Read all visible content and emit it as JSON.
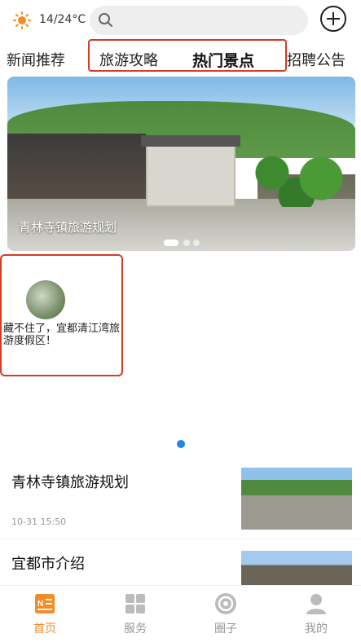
{
  "header": {
    "weather_icon": "sun-icon",
    "temperature": "14/24°C",
    "search_placeholder": "",
    "add_icon": "plus-circle-icon"
  },
  "tabs": [
    {
      "label": "新闻推荐",
      "active": false
    },
    {
      "label": "旅游攻略",
      "active": false
    },
    {
      "label": "热门景点",
      "active": true
    },
    {
      "label": "招聘公告",
      "active": false
    }
  ],
  "banner": {
    "caption": "青林寺镇旅游规划",
    "slide_count": 3,
    "active_slide": 1
  },
  "card": {
    "title": "藏不住了，宜都清江湾旅游度假区！"
  },
  "articles": [
    {
      "title": "青林寺镇旅游规划",
      "time": "10-31 15:50"
    },
    {
      "title": "宜都市介绍",
      "time": ""
    }
  ],
  "bottom_nav": [
    {
      "label": "首页",
      "icon": "news-icon",
      "active": true
    },
    {
      "label": "服务",
      "icon": "grid-icon",
      "active": false
    },
    {
      "label": "圈子",
      "icon": "spiral-icon",
      "active": false
    },
    {
      "label": "我的",
      "icon": "user-icon",
      "active": false
    }
  ],
  "colors": {
    "accent": "#f28c28",
    "highlight_border": "#d63b25",
    "pager_dot": "#1e88e5"
  }
}
